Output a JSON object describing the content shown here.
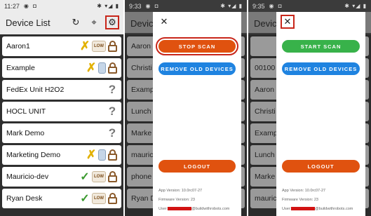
{
  "phone1": {
    "status": {
      "time": "11:27"
    },
    "title": "Device List",
    "devices": [
      {
        "name": "Aaron1",
        "status": "warn",
        "low": "LOW",
        "lock": true
      },
      {
        "name": "Example",
        "status": "warn",
        "low": "",
        "lock": true
      },
      {
        "name": "FedEx Unit H2O2",
        "status": "unknown",
        "low": "",
        "lock": false
      },
      {
        "name": "HOCL UNIT",
        "status": "unknown",
        "low": "",
        "lock": false
      },
      {
        "name": "Mark Demo",
        "status": "unknown",
        "low": "",
        "lock": false
      },
      {
        "name": "Marketing Demo",
        "status": "warn",
        "low": "",
        "lock": true
      },
      {
        "name": "Mauricio-dev",
        "status": "ok",
        "low": "LOW",
        "lock": true
      },
      {
        "name": "Ryan Desk",
        "status": "ok",
        "low": "LOW",
        "lock": true
      }
    ]
  },
  "phone2": {
    "status": {
      "time": "9:33"
    },
    "bg_title": "Device",
    "bg_rows": [
      "Aaron",
      "Christi",
      "Examp",
      "Lunch",
      "Marke",
      "mauric",
      "phone",
      "Ryan D"
    ],
    "buttons": {
      "scan": "STOP SCAN",
      "remove": "REMOVE OLD DEVICES",
      "logout": "LOGOUT"
    },
    "app_version": "App Version: 10.0rc07-27",
    "firmware_version": "Firmware Version: 23",
    "user_prefix": "User:",
    "user_suffix": "@buildwithrobots.com"
  },
  "phone3": {
    "status": {
      "time": "9:35"
    },
    "bg_title": "Device",
    "bg_rows": [
      "",
      "00100",
      "Aaron",
      "Christi",
      "Examp",
      "Lunch",
      "Marke",
      "mauric"
    ],
    "buttons": {
      "scan": "START SCAN",
      "remove": "REMOVE OLD DEVICES",
      "logout": "LOGOUT"
    },
    "app_version": "App Version: 10.0rc07-27",
    "firmware_version": "Firmware Version: 23",
    "user_prefix": "User:",
    "user_suffix": "@buildwithrobots.com"
  },
  "icons": {
    "refresh": "refresh-icon",
    "locate": "locate-icon",
    "settings": "gear-icon",
    "close": "close-icon",
    "warn": "x-mark-icon",
    "ok": "checkmark-icon",
    "unknown": "question-icon",
    "lock": "lock-icon"
  },
  "colors": {
    "stop": "#e0520f",
    "start": "#38b24a",
    "remove": "#1f83e0",
    "logout": "#e0520f",
    "highlight": "#c8261a"
  }
}
